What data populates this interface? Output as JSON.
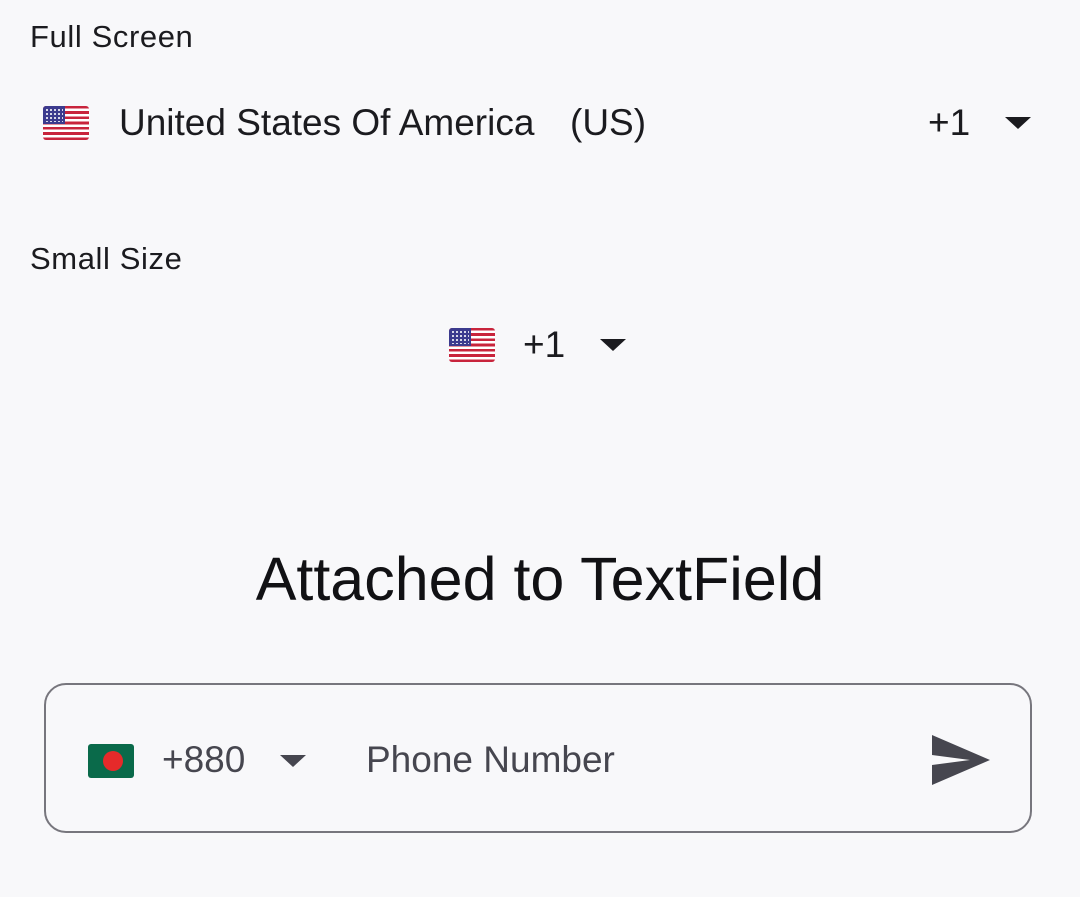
{
  "full_screen": {
    "label": "Full Screen",
    "country_name": "United States Of America",
    "country_iso": "(US)",
    "dial_code": "+1",
    "flag_icon": "flag-us-icon"
  },
  "small_size": {
    "label": "Small Size",
    "dial_code": "+1",
    "flag_icon": "flag-us-icon"
  },
  "attached": {
    "heading": "Attached to TextField",
    "dial_code": "+880",
    "flag_icon": "flag-bd-icon",
    "phone_value": "",
    "phone_placeholder": "Phone Number",
    "send_icon": "send-icon"
  },
  "colors": {
    "background": "#f8f8fa",
    "text": "#1b1b1f",
    "field_border": "#77767d",
    "field_text": "#46464f"
  }
}
